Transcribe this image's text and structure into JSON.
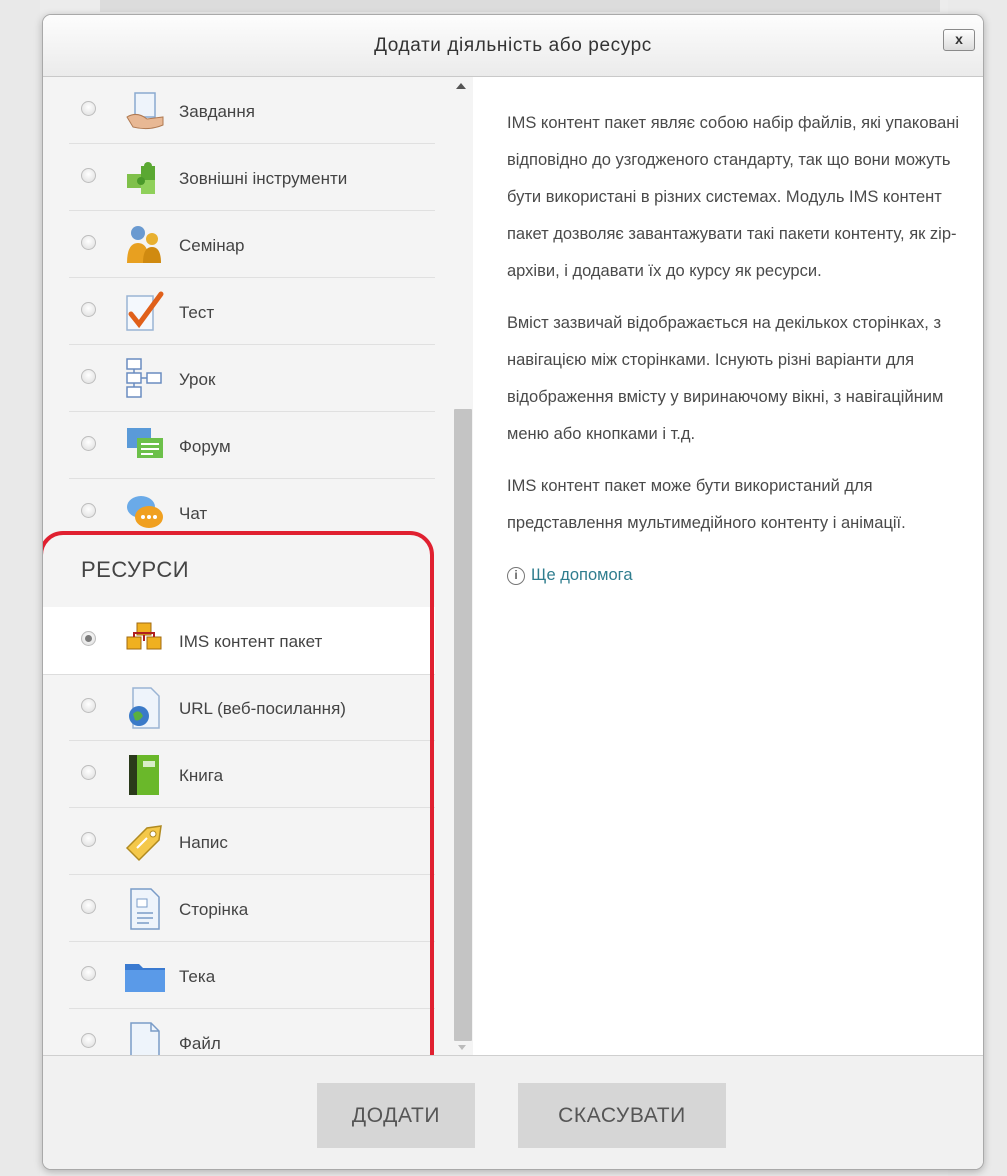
{
  "dialog": {
    "title": "Додати діяльність або ресурс",
    "close_label": "x"
  },
  "activities": [
    {
      "label": "Завдання",
      "icon": "assignment-icon"
    },
    {
      "label": "Зовнішні інструменти",
      "icon": "puzzle-icon"
    },
    {
      "label": "Семінар",
      "icon": "workshop-icon"
    },
    {
      "label": "Тест",
      "icon": "quiz-icon"
    },
    {
      "label": "Урок",
      "icon": "lesson-icon"
    },
    {
      "label": "Форум",
      "icon": "forum-icon"
    },
    {
      "label": "Чат",
      "icon": "chat-icon"
    }
  ],
  "resources_section": {
    "title": "РЕСУРСИ",
    "items": [
      {
        "label": "IMS контент пакет",
        "icon": "ims-package-icon",
        "selected": true
      },
      {
        "label": "URL (веб-посилання)",
        "icon": "url-icon",
        "selected": false
      },
      {
        "label": "Книга",
        "icon": "book-icon",
        "selected": false
      },
      {
        "label": "Напис",
        "icon": "label-icon",
        "selected": false
      },
      {
        "label": "Сторінка",
        "icon": "page-icon",
        "selected": false
      },
      {
        "label": "Тека",
        "icon": "folder-icon",
        "selected": false
      },
      {
        "label": "Файл",
        "icon": "file-icon",
        "selected": false
      }
    ]
  },
  "description": {
    "paragraphs": [
      "IMS контент пакет являє собою набір файлів, які упаковані відповідно до узгодженого стандарту, так що вони можуть бути використані в різних системах. Модуль IMS контент пакет дозволяє завантажувати такі пакети контенту, як zip-архіви, і додавати їх до курсу як ресурси.",
      "Вміст зазвичай відображається на декількох сторінках, з навігацією між сторінками. Існують різні варіанти для відображення вмісту у виринаючому вікні, з навігаційним меню або кнопками і т.д.",
      "IMS контент пакет може бути використаний для представлення мультимедійного контенту і анімації."
    ],
    "help_link": "Ще допомога"
  },
  "footer": {
    "add_label": "ДОДАТИ",
    "cancel_label": "СКАСУВАТИ"
  },
  "colors": {
    "highlight": "#e02030",
    "link": "#2f7d8e"
  }
}
